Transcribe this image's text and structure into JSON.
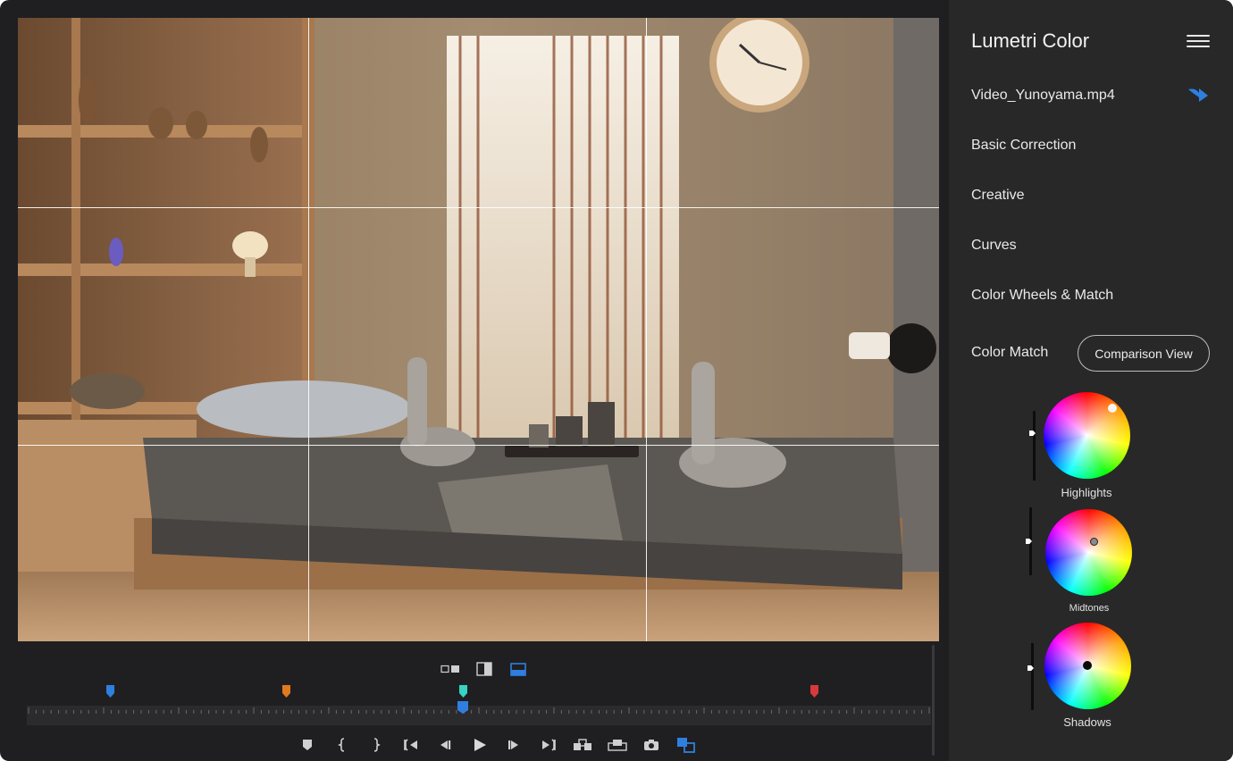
{
  "panel": {
    "title": "Lumetri Color",
    "file_name": "Video_Yunoyama.mp4",
    "sections": [
      "Basic Correction",
      "Creative",
      "Curves",
      "Color Wheels & Match"
    ],
    "color_match_label": "Color Match",
    "comparison_button": "Comparison View",
    "wheels": [
      {
        "label": "Highlights",
        "slider_level": 0.3
      },
      {
        "label": "Midtones",
        "slider_level": 0.5
      },
      {
        "label": "Shadows",
        "slider_level": 0.4
      }
    ]
  },
  "timeline": {
    "view_modes": [
      "side-by-side-icon",
      "split-view-icon",
      "single-view-icon"
    ],
    "active_view_mode": "single-view-icon",
    "markers": [
      {
        "color": "#2f7fe0"
      },
      {
        "color": "#e07a1f"
      },
      {
        "color": "#35d4c4"
      },
      {
        "color": "#d63a3a"
      }
    ],
    "transport_icons": [
      "add-marker-icon",
      "mark-in-icon",
      "mark-out-icon",
      "go-to-in-icon",
      "step-back-icon",
      "play-icon",
      "step-forward-icon",
      "go-to-out-icon",
      "insert-icon",
      "overwrite-icon",
      "export-frame-icon",
      "comparison-view-icon"
    ]
  },
  "colors": {
    "accent": "#2f7fe0",
    "background": "#1f1f21",
    "panel": "#282829"
  }
}
